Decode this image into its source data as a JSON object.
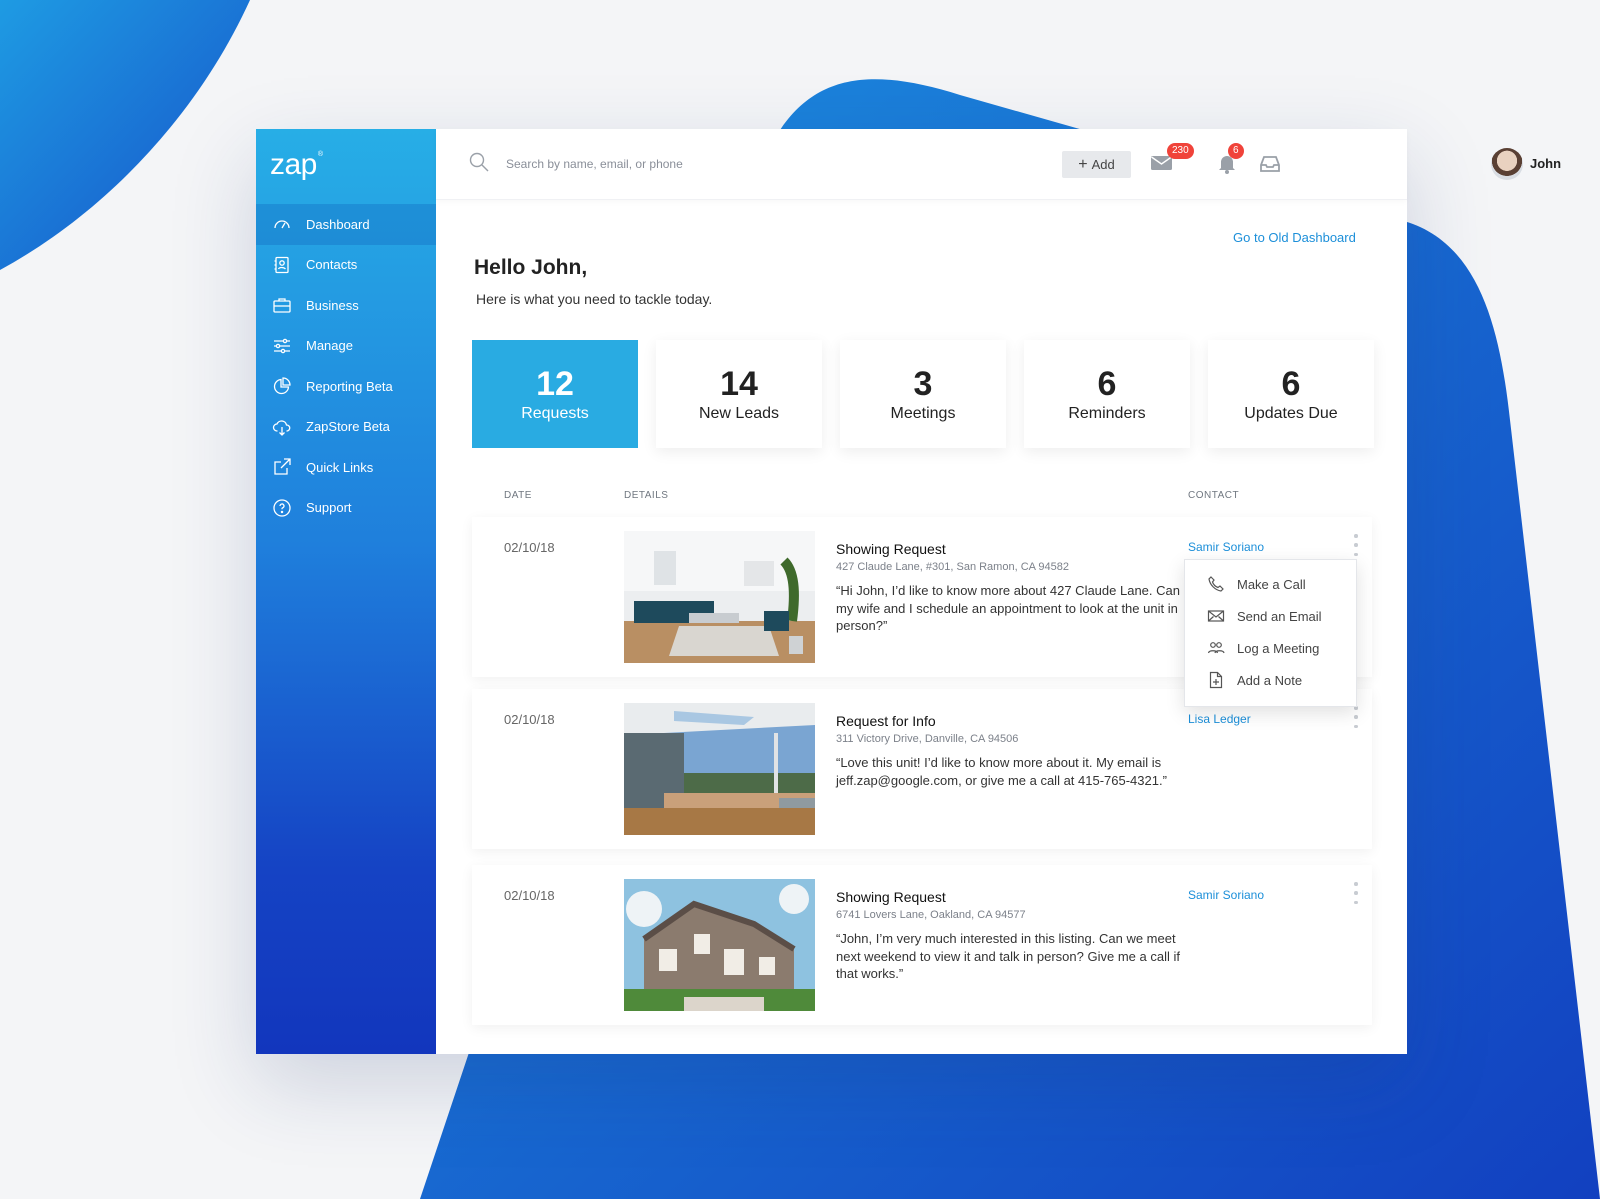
{
  "app": {
    "logo_text": "zap",
    "logo_mark": "®"
  },
  "sidebar": {
    "items": [
      {
        "label": "Dashboard",
        "icon": "gauge-icon",
        "active": true
      },
      {
        "label": "Contacts",
        "icon": "address-book-icon",
        "active": false
      },
      {
        "label": "Business",
        "icon": "briefcase-icon",
        "active": false
      },
      {
        "label": "Manage",
        "icon": "sliders-icon",
        "active": false
      },
      {
        "label": "Reporting Beta",
        "icon": "pie-chart-icon",
        "active": false
      },
      {
        "label": "ZapStore Beta",
        "icon": "cloud-download-icon",
        "active": false
      },
      {
        "label": "Quick Links",
        "icon": "external-link-icon",
        "active": false
      },
      {
        "label": "Support",
        "icon": "help-circle-icon",
        "active": false
      }
    ]
  },
  "header": {
    "search_placeholder": "Search by name, email, or phone",
    "add_label": "Add",
    "mail_count": "230",
    "notification_count": "6",
    "user_name": "John"
  },
  "main": {
    "old_dashboard_link": "Go to Old Dashboard",
    "greeting": "Hello John,",
    "subgreeting": "Here is what you need to tackle today."
  },
  "stats": [
    {
      "value": "12",
      "label": "Requests",
      "active": true
    },
    {
      "value": "14",
      "label": "New Leads",
      "active": false
    },
    {
      "value": "3",
      "label": "Meetings",
      "active": false
    },
    {
      "value": "6",
      "label": "Reminders",
      "active": false
    },
    {
      "value": "6",
      "label": "Updates Due",
      "active": false
    }
  ],
  "table": {
    "headers": {
      "date": "DATE",
      "details": "DETAILS",
      "contact": "CONTACT"
    },
    "rows": [
      {
        "date": "02/10/18",
        "title": "Showing Request",
        "address": "427 Claude Lane, #301, San Ramon, CA 94582",
        "message": "“Hi John, I’d like to know more about 427 Claude Lane. Can my wife and I schedule an appointment to look at the unit in person?”",
        "contact": "Samir Soriano",
        "image": "living-room-photo"
      },
      {
        "date": "02/10/18",
        "title": "Request for Info",
        "address": "311 Victory Drive, Danville, CA 94506",
        "message": "“Love this unit! I’d like to know more about it. My email is jeff.zap@google.com, or give me a call at 415-765-4321.”",
        "contact": "Lisa Ledger",
        "image": "patio-view-photo"
      },
      {
        "date": "02/10/18",
        "title": "Showing Request",
        "address": "6741 Lovers Lane, Oakland, CA 94577",
        "message": "“John, I’m very much interested in this listing. Can we meet next weekend to view it and talk in person? Give me a call if that works.”",
        "contact": "Samir Soriano",
        "image": "house-exterior-photo"
      }
    ]
  },
  "contact_menu": {
    "items": [
      {
        "label": "Make a Call",
        "icon": "phone-icon"
      },
      {
        "label": "Send an Email",
        "icon": "envelope-icon"
      },
      {
        "label": "Log a Meeting",
        "icon": "people-icon"
      },
      {
        "label": "Add a Note",
        "icon": "note-add-icon"
      }
    ]
  },
  "colors": {
    "accent": "#29abe2",
    "link": "#1c8fd9",
    "badge": "#f0433a",
    "sidebar_top": "#27aee6",
    "sidebar_bottom": "#1236bd"
  }
}
